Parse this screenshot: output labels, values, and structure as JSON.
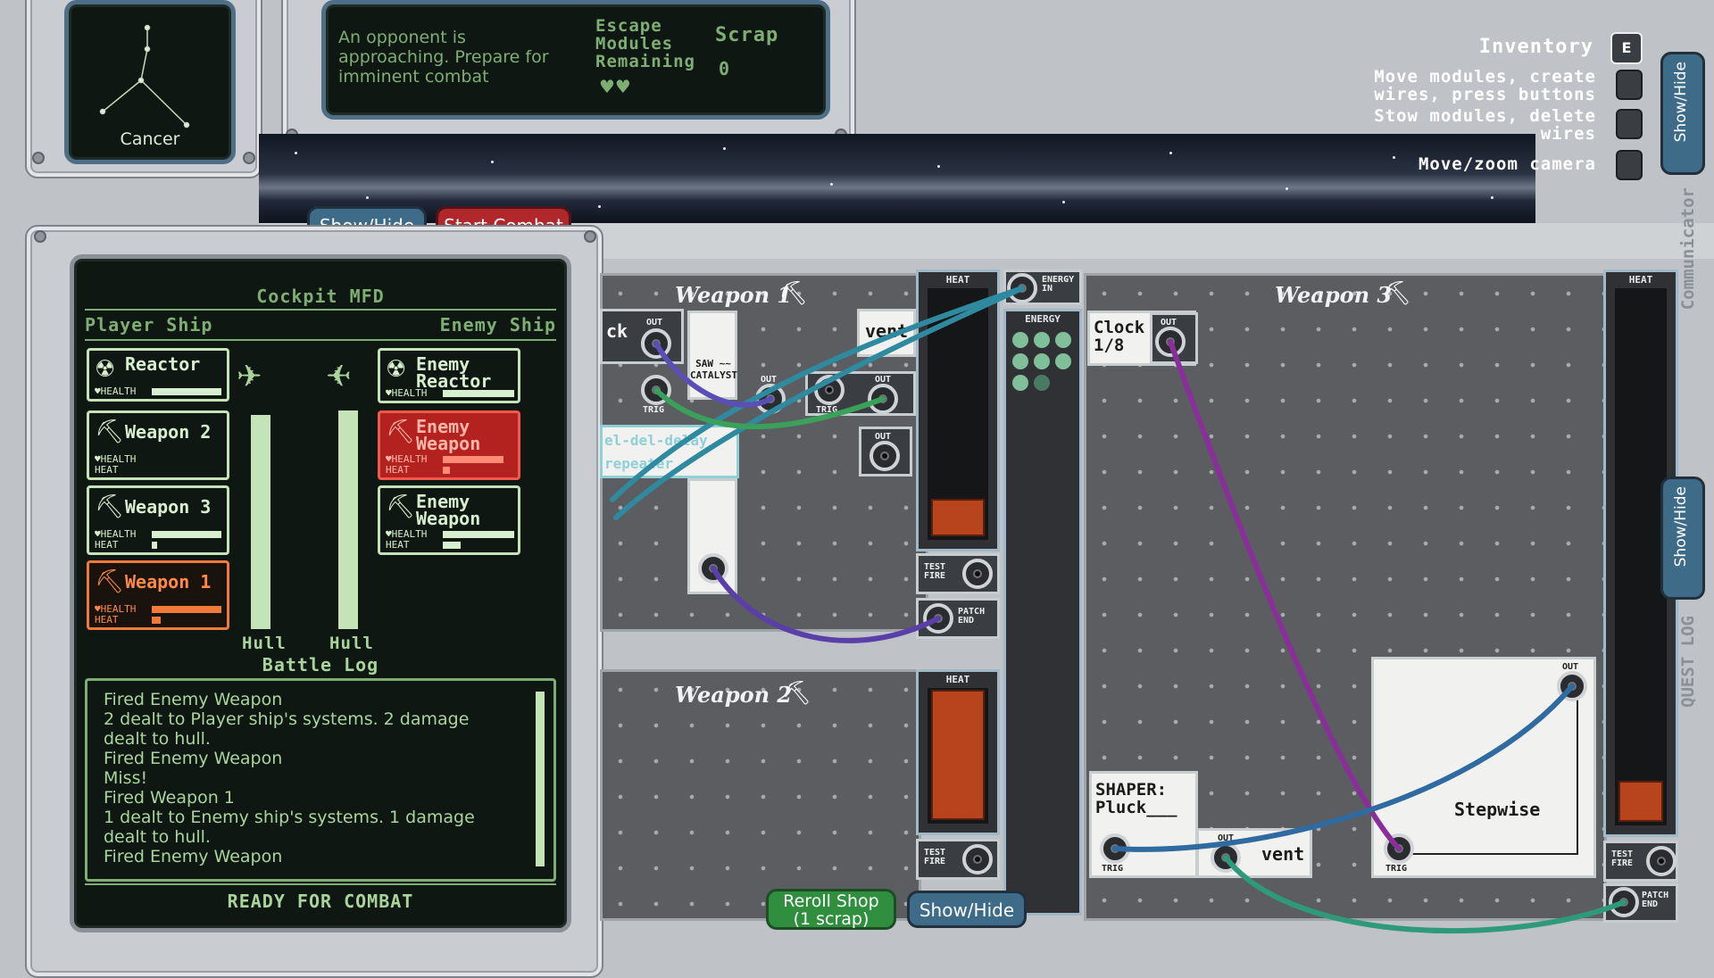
{
  "constellation": {
    "name": "Cancer"
  },
  "status": {
    "message": "An opponent is approaching. Prepare for imminent combat",
    "escape_label": "Escape Modules Remaining",
    "escape_hearts": "♥♥",
    "scrap_label": "Scrap",
    "scrap_value": "0"
  },
  "controls": {
    "inventory_label": "Inventory",
    "inventory_key": "E",
    "hints": [
      "Move modules, create wires, press buttons",
      "Stow modules, delete wires",
      "Move/zoom camera"
    ]
  },
  "top_buttons": {
    "show_hide": "Show/Hide",
    "start_combat": "Start Combat"
  },
  "mfd": {
    "title": "Cockpit MFD",
    "player_label": "Player Ship",
    "enemy_label": "Enemy Ship",
    "player_systems": [
      {
        "name": "Reactor",
        "icon": "reactor-icon",
        "health_label": "♥HEALTH",
        "health": 1.0
      },
      {
        "name": "Weapon 2",
        "icon": "weapon-icon",
        "health_label": "♥HEALTH",
        "heat_label": "HEAT",
        "health": 0.0,
        "heat": 0.0
      },
      {
        "name": "Weapon 3",
        "icon": "weapon-icon",
        "health_label": "♥HEALTH",
        "heat_label": "HEAT",
        "health": 1.0,
        "heat": 0.05
      },
      {
        "name": "Weapon 1",
        "icon": "weapon-icon",
        "health_label": "♥HEALTH",
        "heat_label": "HEAT",
        "health": 1.0,
        "heat": 0.1
      }
    ],
    "enemy_systems": [
      {
        "name": "Enemy Reactor",
        "icon": "reactor-icon",
        "health_label": "♥HEALTH",
        "health": 1.0
      },
      {
        "name": "Enemy Weapon",
        "icon": "weapon-icon",
        "health_label": "♥HEALTH",
        "heat_label": "HEAT",
        "health": 0.85,
        "heat": 0.1
      },
      {
        "name": "Enemy Weapon",
        "icon": "weapon-icon",
        "health_label": "♥HEALTH",
        "heat_label": "HEAT",
        "health": 1.0,
        "heat": 0.25
      }
    ],
    "hull_label": "Hull",
    "player_hull": 1.0,
    "enemy_hull": 1.0,
    "battle_log_title": "Battle Log",
    "battle_log": [
      "Fired Enemy Weapon",
      "2 dealt to Player ship's systems. 2 damage dealt to hull.",
      "Fired Enemy Weapon",
      "Miss!",
      "Fired Weapon 1",
      "1 dealt to Enemy ship's systems. 1 damage dealt to hull.",
      "Fired Enemy Weapon"
    ],
    "footer": "READY FOR COMBAT"
  },
  "boards": {
    "weapon1": "Weapon 1",
    "weapon2": "Weapon 2",
    "weapon3": "Weapon 3"
  },
  "labels": {
    "heat": "HEAT",
    "energy": "ENERGY",
    "energy_in": "ENERGY IN",
    "out": "OUT",
    "trig": "TRIG",
    "test_fire": "TEST FIRE",
    "patch_end": "PATCH END"
  },
  "heat_levels": {
    "weapon1": 0.15,
    "weapon2": 1.0,
    "weapon3": 0.15
  },
  "modules": {
    "clock_fragment": "ck",
    "saw_catalyst": "SAW ~~ CATALYST",
    "vent": "vent",
    "delay_repeater": "el-del-delay repeater",
    "clock": "Clock 1/8",
    "shaper": "SHAPER: Pluck___",
    "stepwise": "Stepwise"
  },
  "bottom_buttons": {
    "reroll": "Reroll Shop",
    "reroll_cost": "(1 scrap)",
    "show_hide": "Show/Hide"
  },
  "side_tabs": {
    "show_hide": "Show/Hide",
    "communicator": "Communicator",
    "quest_log": "QUEST LOG"
  }
}
